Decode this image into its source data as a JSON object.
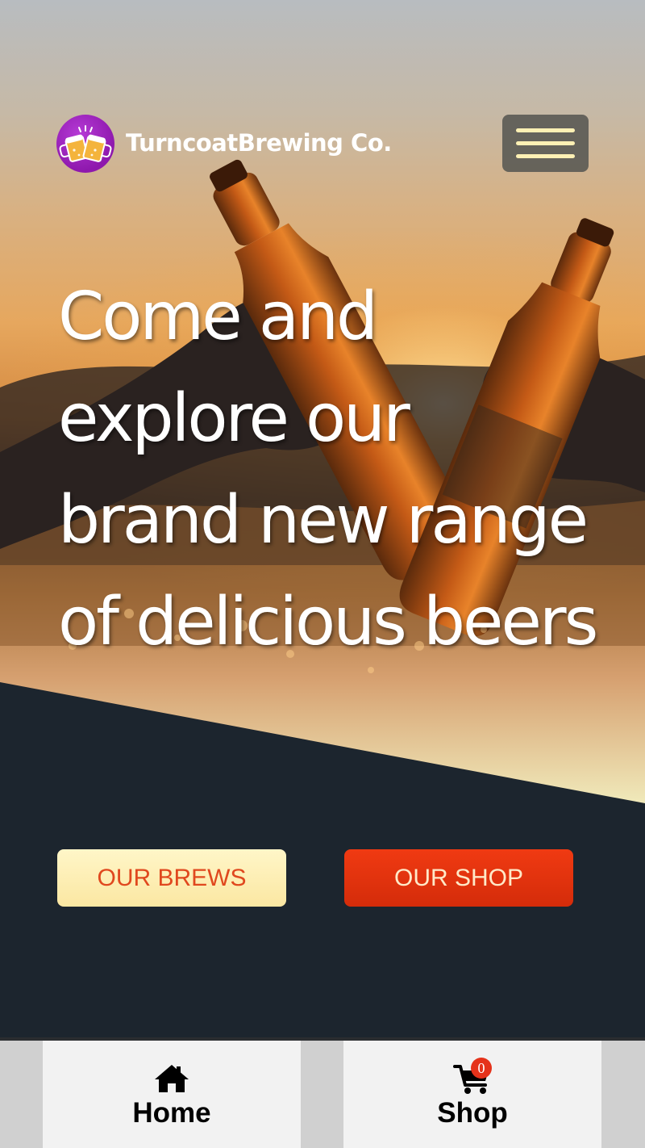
{
  "header": {
    "brand_name": "TurncoatBrewing Co.",
    "logo_icon": "beer-mugs-cheers-icon",
    "menu_icon": "hamburger-menu-icon"
  },
  "hero": {
    "headline_lines": [
      "Come and",
      "explore our",
      "brand new range",
      "of delicious beers"
    ],
    "background_image": "two beer bottles clinking at sunset"
  },
  "cta": {
    "brews_label": "OUR BREWS",
    "shop_label": "OUR SHOP"
  },
  "bottom_nav": {
    "home_label": "Home",
    "home_icon": "home-icon",
    "shop_label": "Shop",
    "shop_icon": "shopping-cart-icon",
    "cart_count": "0"
  },
  "colors": {
    "page_dark": "#1c252e",
    "logo_purple": "#9a1fba",
    "menu_lines": "#fdf0b4",
    "brews_button": "#fdf0b4",
    "brews_text": "#e0481e",
    "shop_button": "#e6330f",
    "cart_badge": "#e5321a"
  }
}
